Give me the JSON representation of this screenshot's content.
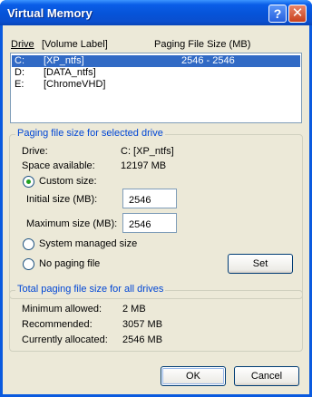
{
  "window": {
    "title": "Virtual Memory",
    "help_glyph": "?",
    "close_glyph": "✕"
  },
  "drives": {
    "col_drive": "Drive",
    "col_label": "[Volume Label]",
    "col_size": "Paging File Size (MB)",
    "rows": [
      {
        "letter": "C:",
        "label": "[XP_ntfs]",
        "size": "2546 - 2546",
        "selected": true
      },
      {
        "letter": "D:",
        "label": "[DATA_ntfs]",
        "size": "",
        "selected": false
      },
      {
        "letter": "E:",
        "label": "[ChromeVHD]",
        "size": "",
        "selected": false
      }
    ]
  },
  "selected_drive": {
    "group_title": "Paging file size for selected drive",
    "drive_label": "Drive:",
    "drive_value": "C:  [XP_ntfs]",
    "space_label": "Space available:",
    "space_value": "12197 MB",
    "custom_label": "Custom size:",
    "initial_label": "Initial size (MB):",
    "initial_value": "2546",
    "max_label": "Maximum size (MB):",
    "max_value": "2546",
    "system_label": "System managed size",
    "nopaging_label": "No paging file",
    "set_label": "Set"
  },
  "totals": {
    "group_title": "Total paging file size for all drives",
    "min_label": "Minimum allowed:",
    "min_value": "2 MB",
    "rec_label": "Recommended:",
    "rec_value": "3057 MB",
    "cur_label": "Currently allocated:",
    "cur_value": "2546 MB"
  },
  "buttons": {
    "ok": "OK",
    "cancel": "Cancel"
  },
  "colors": {
    "title_bar": "#0a5adf",
    "selection": "#316ac5",
    "group_title": "#0046d5",
    "face": "#ece9d8"
  }
}
